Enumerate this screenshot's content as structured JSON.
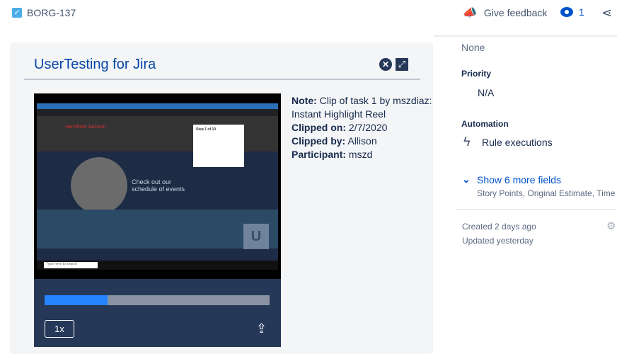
{
  "header": {
    "issue_key": "BORG-137",
    "feedback_label": "Give feedback",
    "watch_count": "1"
  },
  "panel": {
    "title": "UserTesting for Jira"
  },
  "video": {
    "speed": "1x",
    "progress": 0.28,
    "frame": {
      "step": "Step 1 of 10",
      "brand": "Hartsfield-Jackson",
      "headline": "Check out our schedule of events",
      "search": "Type here to search"
    }
  },
  "clip": {
    "note_label": "Note:",
    "note": "Clip of task 1 by mszdiaz: Instant Highlight Reel",
    "clipped_on_label": "Clipped on:",
    "clipped_on": "2/7/2020",
    "clipped_by_label": "Clipped by:",
    "clipped_by": "Allison",
    "participant_label": "Participant:",
    "participant": "mszd"
  },
  "sidebar": {
    "none_value": "None",
    "priority_label": "Priority",
    "priority_value": "N/A",
    "automation_label": "Automation",
    "rule_executions": "Rule executions",
    "show_more": "Show 6 more fields",
    "more_fields": "Story Points, Original Estimate, Time tracking",
    "created": "Created 2 days ago",
    "updated": "Updated yesterday"
  }
}
